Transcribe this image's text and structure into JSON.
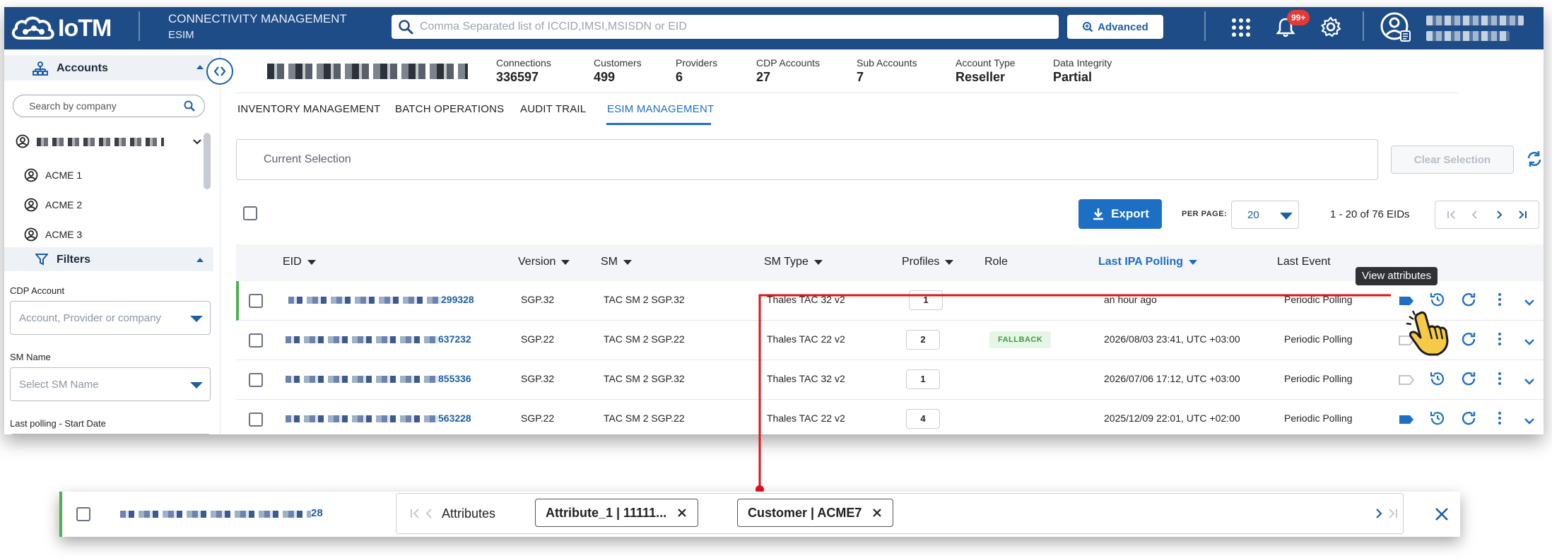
{
  "header": {
    "brand": "IoTM",
    "module_title": "CONNECTIVITY MANAGEMENT",
    "module_sub": "ESIM",
    "search_placeholder": "Comma Separated list of ICCID,IMSI,MSISDN or EID",
    "advanced_label": "Advanced",
    "notifications_badge": "99+"
  },
  "sidebar": {
    "accounts_label": "Accounts",
    "company_search_placeholder": "Search by company",
    "companies": [
      "ACME 1",
      "ACME 2",
      "ACME 3"
    ],
    "filters_label": "Filters",
    "filters": [
      {
        "label": "CDP Account",
        "placeholder": "Account, Provider or company"
      },
      {
        "label": "SM Name",
        "placeholder": "Select SM Name"
      },
      {
        "label": "Last polling - Start Date",
        "placeholder": ""
      }
    ]
  },
  "summary": {
    "stats": [
      {
        "key": "Connections",
        "value": "336597"
      },
      {
        "key": "Customers",
        "value": "499"
      },
      {
        "key": "Providers",
        "value": "6"
      },
      {
        "key": "CDP Accounts",
        "value": "27"
      },
      {
        "key": "Sub Accounts",
        "value": "7"
      },
      {
        "key": "Account Type",
        "value": "Reseller"
      },
      {
        "key": "Data Integrity",
        "value": "Partial"
      }
    ]
  },
  "tabs": [
    {
      "label": "INVENTORY MANAGEMENT",
      "active": false
    },
    {
      "label": "BATCH OPERATIONS",
      "active": false
    },
    {
      "label": "AUDIT TRAIL",
      "active": false
    },
    {
      "label": "ESIM MANAGEMENT",
      "active": true
    }
  ],
  "selection": {
    "current_label": "Current Selection",
    "clear_label": "Clear Selection"
  },
  "toolbar": {
    "export_label": "Export",
    "per_page_label": "PER PAGE:",
    "per_page_value": "20",
    "range_text": "1 - 20 of 76 EIDs"
  },
  "table": {
    "columns": [
      "EID",
      "Version",
      "SM",
      "SM Type",
      "Profiles",
      "Role",
      "Last IPA Polling",
      "Last Event"
    ],
    "rows": [
      {
        "eid_tail": "299328",
        "version": "SGP.32",
        "sm": "TAC SM 2 SGP.32",
        "sm_type": "Thales TAC 32 v2",
        "profiles": "1",
        "role": "",
        "last_polling": "an hour ago",
        "last_event": "Periodic Polling",
        "attr_filled": true
      },
      {
        "eid_tail": "637232",
        "version": "SGP.22",
        "sm": "TAC SM 2 SGP.22",
        "sm_type": "Thales TAC 22 v2",
        "profiles": "2",
        "role": "FALLBACK",
        "last_polling": "2026/08/03 23:41, UTC +03:00",
        "last_event": "Periodic Polling",
        "attr_filled": false
      },
      {
        "eid_tail": "855336",
        "version": "SGP.32",
        "sm": "TAC SM 2 SGP.32",
        "sm_type": "Thales TAC 32 v2",
        "profiles": "1",
        "role": "",
        "last_polling": "2026/07/06 17:12, UTC +03:00",
        "last_event": "Periodic Polling",
        "attr_filled": false
      },
      {
        "eid_tail": "563228",
        "version": "SGP.22",
        "sm": "TAC SM 2 SGP.22",
        "sm_type": "Thales TAC 22 v2",
        "profiles": "4",
        "role": "",
        "last_polling": "2025/12/09 22:01, UTC +02:00",
        "last_event": "Periodic Polling",
        "attr_filled": true
      }
    ]
  },
  "tooltip": "View attributes",
  "detail": {
    "eid_tail": "28",
    "attributes_label": "Attributes",
    "chips": [
      "Attribute_1 | 11111...",
      "Customer | ACME7"
    ]
  },
  "colors": {
    "brand_blue": "#1d4c86",
    "accent_blue": "#1d6fc4",
    "connector_red": "#e0141e",
    "selected_green": "#4caf50"
  }
}
